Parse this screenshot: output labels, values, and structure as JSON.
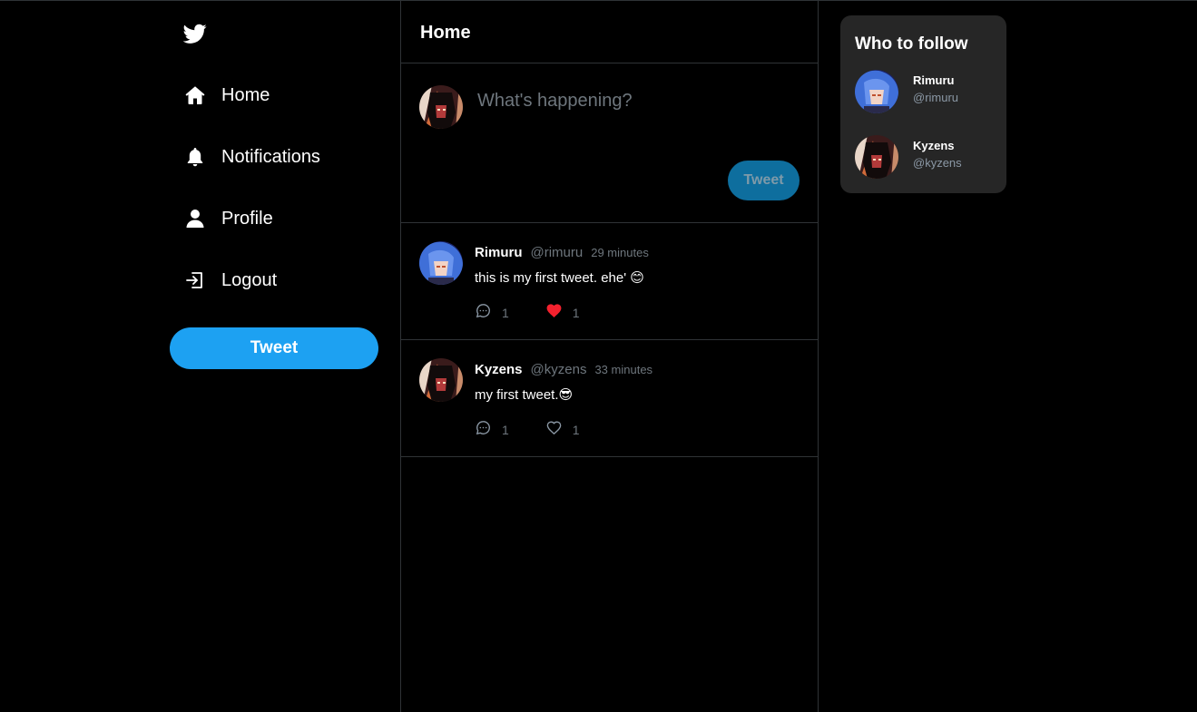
{
  "sidebar": {
    "logo_icon": "twitter-bird-icon",
    "items": [
      {
        "label": "Home",
        "icon": "home-icon"
      },
      {
        "label": "Notifications",
        "icon": "bell-icon"
      },
      {
        "label": "Profile",
        "icon": "user-icon"
      },
      {
        "label": "Logout",
        "icon": "logout-icon"
      }
    ],
    "tweet_button": "Tweet"
  },
  "feed": {
    "title": "Home",
    "composer": {
      "placeholder": "What's happening?",
      "tweet_button": "Tweet"
    },
    "tweets": [
      {
        "name": "Rimuru",
        "handle": "@rimuru",
        "time": "29 minutes",
        "text": "this is my first tweet. ehe' 😊",
        "replies": "1",
        "likes": "1",
        "liked": true
      },
      {
        "name": "Kyzens",
        "handle": "@kyzens",
        "time": "33 minutes",
        "text": "my first tweet.😎",
        "replies": "1",
        "likes": "1",
        "liked": false
      }
    ]
  },
  "who_to_follow": {
    "title": "Who to follow",
    "users": [
      {
        "name": "Rimuru",
        "handle": "@rimuru"
      },
      {
        "name": "Kyzens",
        "handle": "@kyzens"
      }
    ]
  },
  "colors": {
    "accent": "#1da1f2",
    "like": "#f4212e",
    "border": "#2f3336",
    "card": "#262626"
  }
}
